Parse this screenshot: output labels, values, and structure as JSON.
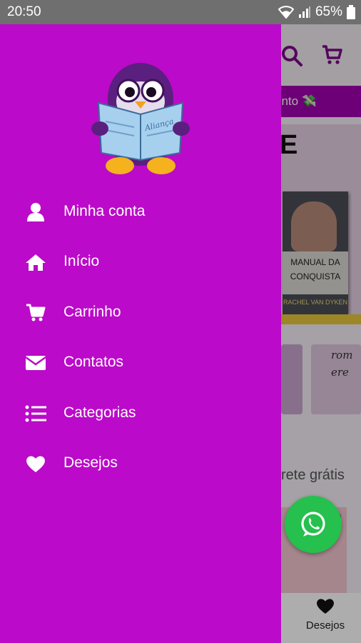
{
  "status_bar": {
    "time": "20:50",
    "battery": "65%"
  },
  "background_app": {
    "promo_text": "sconto 💸",
    "banner_letter": "E",
    "book_title_line1": "MANUAL DA",
    "book_title_line2": "CONQUISTA",
    "book_author": "RACHEL VAN DYKEN",
    "card_text_line1": "rom",
    "card_text_line2": "ere",
    "section_text": "rete grátis",
    "bottom_nav_label": "Desejos"
  },
  "drawer": {
    "logo_icon": "reading-penguin-mascot",
    "logo_book_text": "Aliança",
    "menu": [
      {
        "label": "Minha conta",
        "icon": "user-icon"
      },
      {
        "label": "Início",
        "icon": "home-icon"
      },
      {
        "label": "Carrinho",
        "icon": "cart-icon"
      },
      {
        "label": "Contatos",
        "icon": "envelope-icon"
      },
      {
        "label": "Categorias",
        "icon": "list-icon"
      },
      {
        "label": "Desejos",
        "icon": "heart-icon"
      }
    ]
  },
  "colors": {
    "drawer_bg": "#bb0ac9",
    "promo_bg": "#a300b0",
    "whatsapp": "#25c04d"
  }
}
